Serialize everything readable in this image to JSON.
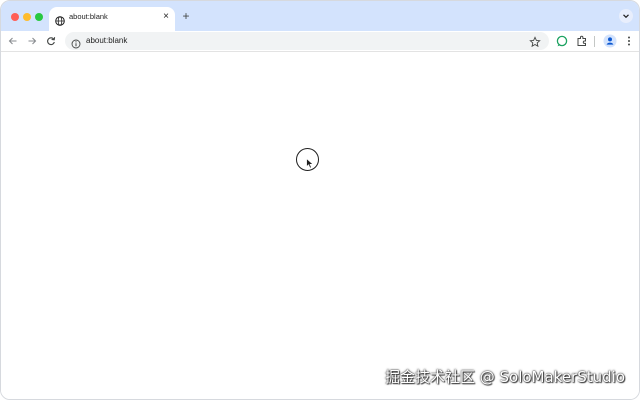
{
  "browser": {
    "tab": {
      "title": "about:blank",
      "favicon": "globe-icon",
      "close_glyph": "×"
    },
    "new_tab_glyph": "+",
    "address_bar": {
      "url": "about:blank",
      "leading_icon": "info-icon"
    },
    "toolbar_icons": [
      "back-arrow-icon",
      "forward-arrow-icon",
      "reload-icon",
      "star-icon",
      "extension-chat-icon",
      "puzzle-icon",
      "profile-icon",
      "kebab-menu-icon"
    ],
    "colors": {
      "tabstrip": "#d3e3fd",
      "close": "#ff5f57",
      "minimize": "#febc2e",
      "maximize": "#28c840"
    }
  },
  "page": {
    "content": ""
  },
  "watermark": "掘金技术社区 @ SoloMakerStudio"
}
